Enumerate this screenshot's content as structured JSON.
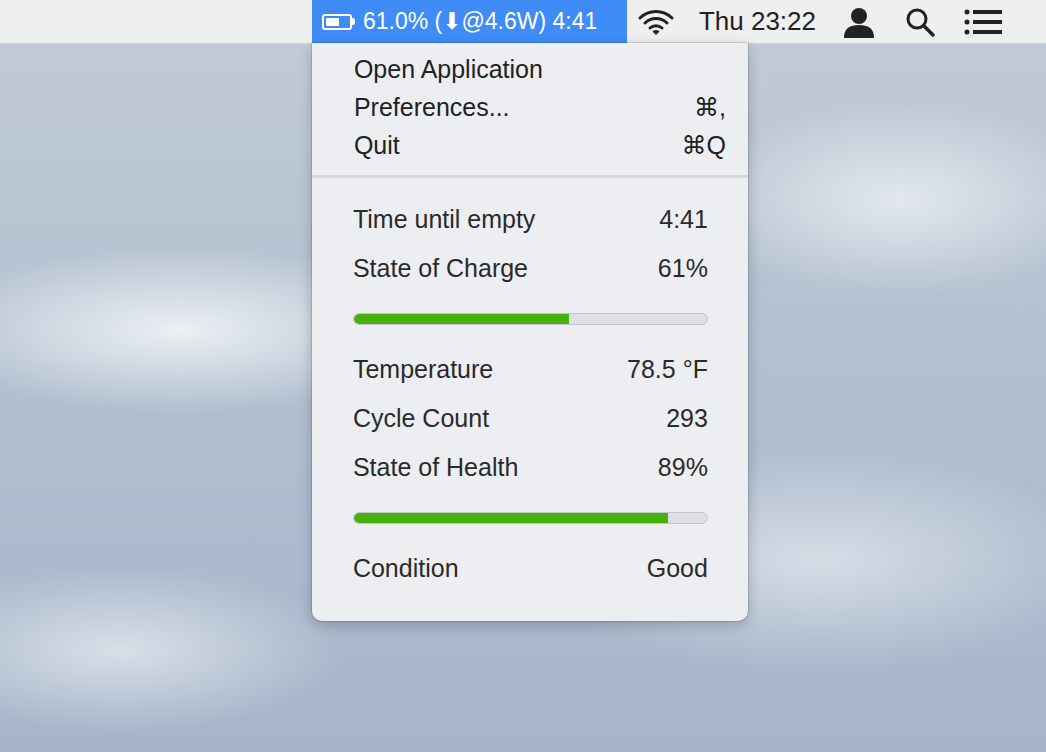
{
  "menu_bar": {
    "status_item": {
      "text": "61.0% (⬇@4.6W) 4:41",
      "selected": true,
      "level": 0.61
    },
    "clock": "Thu 23:22"
  },
  "menu": {
    "items": [
      {
        "label": "Open Application"
      },
      {
        "label": "Preferences...",
        "shortcut": "⌘,"
      },
      {
        "label": "Quit",
        "shortcut": "⌘Q"
      }
    ]
  },
  "info": [
    {
      "kind": "row",
      "label": "Time until empty",
      "value": "4:41"
    },
    {
      "kind": "row",
      "label": "State of Charge",
      "value": "61%"
    },
    {
      "kind": "bar",
      "level": 0.61
    },
    {
      "kind": "row",
      "label": "Temperature",
      "value": "78.5 °F"
    },
    {
      "kind": "row",
      "label": "Cycle Count",
      "value": "293"
    },
    {
      "kind": "row",
      "label": "State of Health",
      "value": "89%"
    },
    {
      "kind": "bar",
      "level": 0.89
    },
    {
      "kind": "row",
      "label": "Condition",
      "value": "Good"
    }
  ]
}
